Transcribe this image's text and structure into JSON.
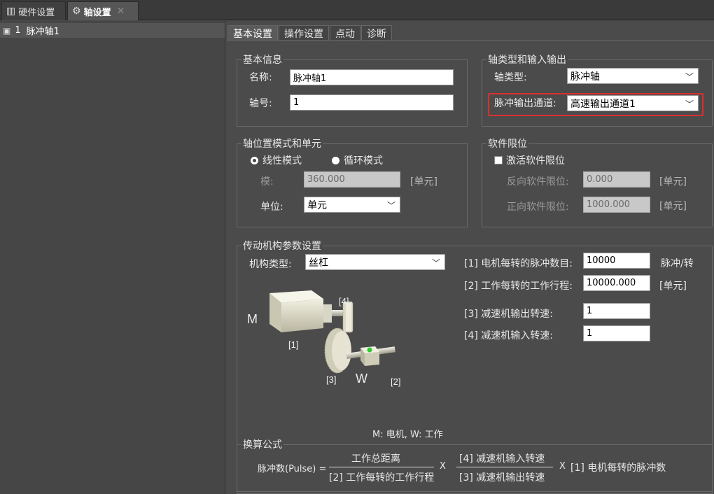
{
  "doc_tabs": [
    {
      "label": "硬件设置",
      "icon": "hardware-icon"
    },
    {
      "label": "轴设置",
      "icon": "gear-icon",
      "close": "✕"
    }
  ],
  "tree": {
    "index": "1",
    "label": "脉冲轴1",
    "icon": "axis-icon"
  },
  "settings_tabs": [
    "基本设置",
    "操作设置",
    "点动",
    "诊断"
  ],
  "basic_info": {
    "legend": "基本信息",
    "name_label": "名称:",
    "name_value": "脉冲轴1",
    "number_label": "轴号:",
    "number_value": "1"
  },
  "axis_io": {
    "legend": "轴类型和输入输出",
    "type_label": "轴类型:",
    "type_value": "脉冲轴",
    "channel_label": "脉冲输出通道:",
    "channel_value": "高速输出通道1"
  },
  "position_mode": {
    "legend": "轴位置模式和单元",
    "linear_label": "线性模式",
    "circular_label": "循环模式",
    "selected": "linear",
    "modulo_label": "模:",
    "modulo_value": "360.000",
    "modulo_unit": "[单元]",
    "unit_label": "单位:",
    "unit_value": "单元"
  },
  "soft_limit": {
    "legend": "软件限位",
    "activate_label": "激活软件限位",
    "activated": false,
    "negative_label": "反向软件限位:",
    "negative_value": "0.000",
    "negative_unit": "[单元]",
    "positive_label": "正向软件限位:",
    "positive_value": "1000.000",
    "positive_unit": "[单元]"
  },
  "drive": {
    "legend": "传动机构参数设置",
    "mech_type_label": "机构类型:",
    "mech_type_value": "丝杠",
    "p1_label": "[1] 电机每转的脉冲数目:",
    "p1_value": "10000",
    "p1_unit": "脉冲/转",
    "p2_label": "[2] 工作每转的工作行程:",
    "p2_value": "10000.000",
    "p2_unit": "[单元]",
    "p3_label": "[3] 减速机输出转速:",
    "p3_value": "1",
    "p4_label": "[4] 减速机输入转速:",
    "p4_value": "1",
    "diagram": {
      "m": "M",
      "w": "W",
      "l1": "[1]",
      "l2": "[2]",
      "l3": "[3]",
      "l4": "[4]"
    },
    "caption": "M: 电机, W: 工作"
  },
  "formula": {
    "legend": "换算公式",
    "lhs": "脉冲数(Pulse) =",
    "num1": "工作总距离",
    "den1": "[2] 工作每转的工作行程",
    "times1": "X",
    "num2": "[4] 减速机输入转速",
    "den2": "[3] 减速机输出转速",
    "times2": "X",
    "tail": "[1] 电机每转的脉冲数"
  },
  "colors": {
    "highlight": "#d93030",
    "panel": "#4b4b4b"
  }
}
